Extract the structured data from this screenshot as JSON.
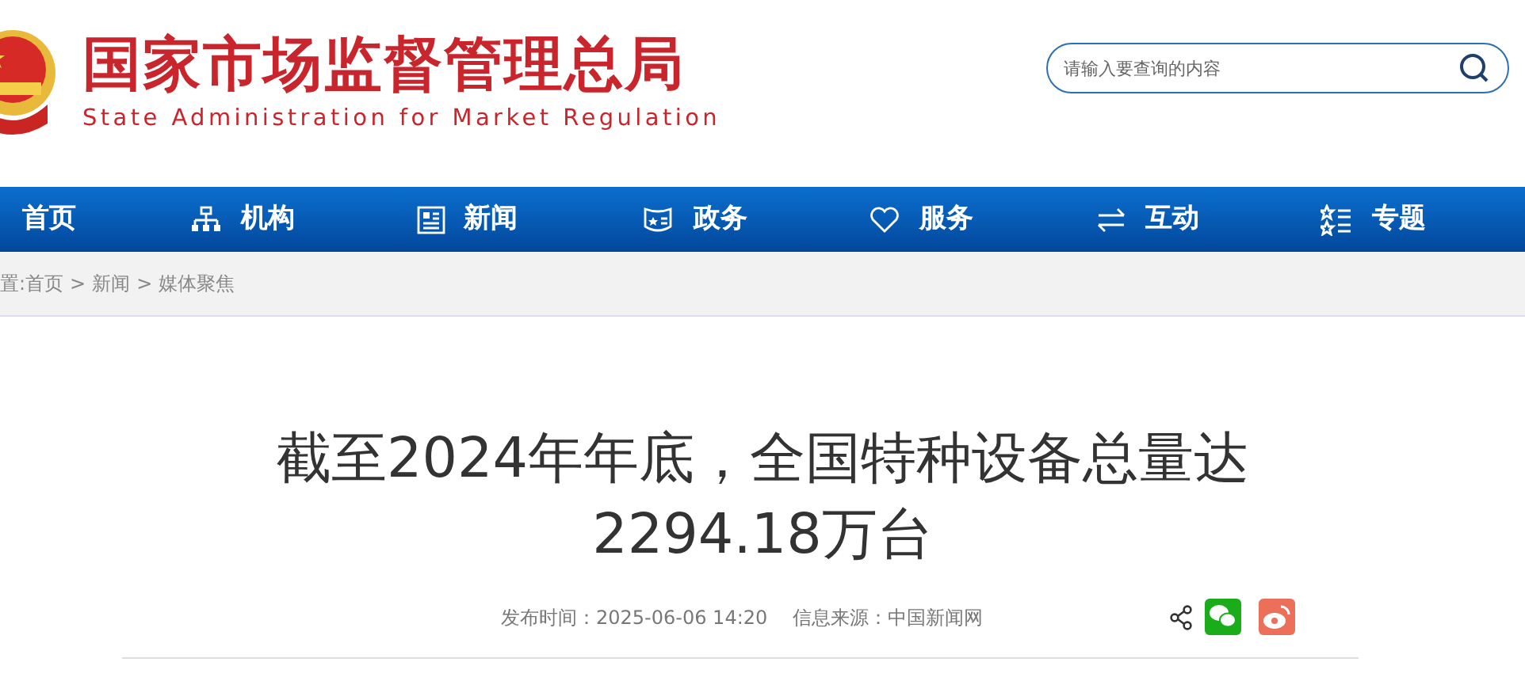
{
  "header": {
    "title": "国家市场监督管理总局",
    "subtitle": "State Administration for Market Regulation"
  },
  "search": {
    "placeholder": "请输入要查询的内容"
  },
  "nav": [
    {
      "label": "首页",
      "kind": "plain"
    },
    {
      "label": "机构",
      "kind": "org"
    },
    {
      "label": "新闻",
      "kind": "news"
    },
    {
      "label": "政务",
      "kind": "shield"
    },
    {
      "label": "服务",
      "kind": "heart"
    },
    {
      "label": "互动",
      "kind": "swap"
    },
    {
      "label": "专题",
      "kind": "stars"
    }
  ],
  "breadcrumb": {
    "prefix": "置:",
    "items": [
      "首页",
      "新闻",
      "媒体聚焦"
    ],
    "separator": ">"
  },
  "article": {
    "title": "截至2024年年底，全国特种设备总量达2294.18万台",
    "publish_label": "发布时间：",
    "publish_time": "2025-06-06 14:20",
    "source_label": "信息来源：",
    "source": "中国新闻网"
  }
}
